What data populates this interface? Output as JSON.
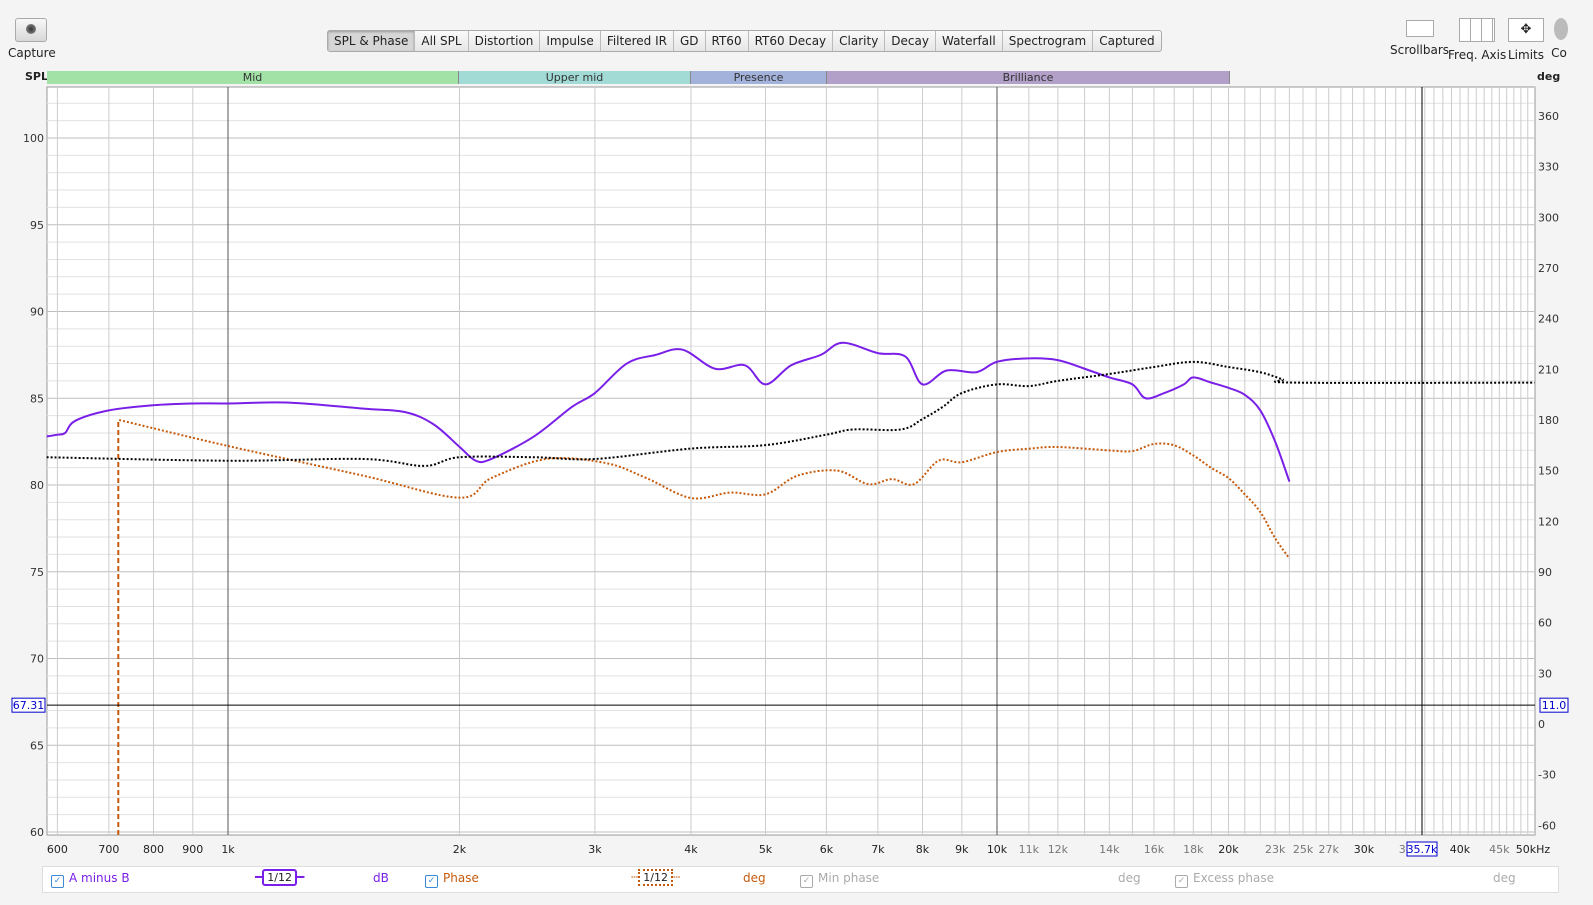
{
  "toolbar": {
    "capture": "Capture",
    "tabs": [
      "SPL & Phase",
      "All SPL",
      "Distortion",
      "Impulse",
      "Filtered IR",
      "GD",
      "RT60",
      "RT60 Decay",
      "Clarity",
      "Decay",
      "Waterfall",
      "Spectrogram",
      "Captured"
    ],
    "active_tab": "SPL & Phase",
    "tools": [
      "Scrollbars",
      "Freq. Axis",
      "Limits",
      "Co"
    ]
  },
  "axes": {
    "left_label": "SPL",
    "right_label": "deg",
    "x_unit_label": "50kHz"
  },
  "bands": [
    {
      "label": "Mid",
      "color": "#a2e2a6"
    },
    {
      "label": "Upper mid",
      "color": "#a2dad6"
    },
    {
      "label": "Presence",
      "color": "#a2b2da"
    },
    {
      "label": "Brilliance",
      "color": "#b2a0c8"
    }
  ],
  "cursor": {
    "spl": "67.31",
    "phase": "11.0",
    "freq": "35.7k"
  },
  "legend": {
    "items": [
      {
        "label": "A minus B",
        "smoothing": "1/12",
        "unit": "dB",
        "checked": true,
        "color": "#7a1fe8"
      },
      {
        "label": "Phase",
        "smoothing": "1/12",
        "unit": "deg",
        "checked": true,
        "color": "#c65a0c"
      },
      {
        "label": "Min phase",
        "unit": "deg",
        "checked": true,
        "disabled": true
      },
      {
        "label": "Excess phase",
        "unit": "deg",
        "checked": true,
        "disabled": true
      }
    ]
  },
  "chart_data": {
    "type": "line",
    "xscale": "log",
    "xlim": [
      581,
      50000
    ],
    "ylim": [
      59.83,
      102.94
    ],
    "y2lim": [
      -66,
      375
    ],
    "xticks": [
      [
        600,
        "600"
      ],
      [
        700,
        "700"
      ],
      [
        800,
        "800"
      ],
      [
        900,
        "900"
      ],
      [
        1000,
        "1k"
      ],
      [
        2000,
        "2k"
      ],
      [
        3000,
        "3k"
      ],
      [
        4000,
        "4k"
      ],
      [
        5000,
        "5k"
      ],
      [
        6000,
        "6k"
      ],
      [
        7000,
        "7k"
      ],
      [
        8000,
        "8k"
      ],
      [
        9000,
        "9k"
      ],
      [
        10000,
        "10k"
      ],
      [
        11000,
        "11k"
      ],
      [
        12000,
        "12k"
      ],
      [
        14000,
        "14k"
      ],
      [
        16000,
        "16k"
      ],
      [
        18000,
        "18k"
      ],
      [
        20000,
        "20k"
      ],
      [
        23000,
        "23k"
      ],
      [
        25000,
        "25k"
      ],
      [
        27000,
        "27k"
      ],
      [
        30000,
        "30k"
      ],
      [
        34000,
        "34"
      ],
      [
        40000,
        "40k"
      ],
      [
        45000,
        "45k"
      ]
    ],
    "yticks": [
      60,
      65,
      70,
      75,
      80,
      85,
      90,
      95,
      100
    ],
    "y2ticks": [
      -60,
      -30,
      0,
      30,
      60,
      90,
      120,
      150,
      180,
      210,
      240,
      270,
      300,
      330,
      360
    ],
    "series": [
      {
        "name": "A minus B",
        "axis": "left",
        "color": "#7a1fe8",
        "style": "solid",
        "points": [
          [
            581,
            82.8
          ],
          [
            600,
            82.9
          ],
          [
            614,
            83.0
          ],
          [
            633,
            83.7
          ],
          [
            700,
            84.3
          ],
          [
            800,
            84.6
          ],
          [
            900,
            84.7
          ],
          [
            1000,
            84.7
          ],
          [
            1200,
            84.75
          ],
          [
            1500,
            84.4
          ],
          [
            1700,
            84.2
          ],
          [
            1850,
            83.5
          ],
          [
            2000,
            82.2
          ],
          [
            2100,
            81.4
          ],
          [
            2200,
            81.5
          ],
          [
            2500,
            82.8
          ],
          [
            2800,
            84.5
          ],
          [
            3000,
            85.3
          ],
          [
            3300,
            87.0
          ],
          [
            3600,
            87.5
          ],
          [
            3900,
            87.8
          ],
          [
            4300,
            86.7
          ],
          [
            4700,
            86.9
          ],
          [
            5000,
            85.8
          ],
          [
            5400,
            86.9
          ],
          [
            5900,
            87.5
          ],
          [
            6300,
            88.2
          ],
          [
            7000,
            87.6
          ],
          [
            7600,
            87.4
          ],
          [
            8000,
            85.8
          ],
          [
            8600,
            86.6
          ],
          [
            9400,
            86.5
          ],
          [
            10000,
            87.1
          ],
          [
            11000,
            87.3
          ],
          [
            12000,
            87.2
          ],
          [
            13000,
            86.7
          ],
          [
            14000,
            86.2
          ],
          [
            15000,
            85.8
          ],
          [
            15600,
            85.0
          ],
          [
            16500,
            85.3
          ],
          [
            17500,
            85.8
          ],
          [
            18000,
            86.2
          ],
          [
            19000,
            85.9
          ],
          [
            20000,
            85.6
          ],
          [
            21000,
            85.2
          ],
          [
            22000,
            84.3
          ],
          [
            23000,
            82.5
          ],
          [
            24000,
            80.2
          ]
        ]
      },
      {
        "name": "Phase",
        "axis": "right",
        "color": "#c65a0c",
        "style": "dotted",
        "points": [
          [
            720,
            -66
          ],
          [
            722,
            180
          ],
          [
            1000,
            164.6
          ],
          [
            1500,
            147
          ],
          [
            2000,
            134
          ],
          [
            2200,
            145.6
          ],
          [
            2600,
            157
          ],
          [
            3100,
            154.5
          ],
          [
            3500,
            145.6
          ],
          [
            4000,
            133.8
          ],
          [
            4500,
            137
          ],
          [
            5000,
            136
          ],
          [
            5500,
            147
          ],
          [
            6200,
            150
          ],
          [
            6800,
            142
          ],
          [
            7300,
            145
          ],
          [
            7800,
            142
          ],
          [
            8400,
            156
          ],
          [
            9000,
            155
          ],
          [
            10000,
            161
          ],
          [
            11000,
            163
          ],
          [
            12000,
            164
          ],
          [
            14000,
            162
          ],
          [
            15000,
            161.6
          ],
          [
            16000,
            165.8
          ],
          [
            17000,
            165
          ],
          [
            18000,
            159
          ],
          [
            19000,
            151.6
          ],
          [
            20000,
            145.6
          ],
          [
            21000,
            136
          ],
          [
            22000,
            125.5
          ],
          [
            23000,
            110
          ],
          [
            24000,
            98
          ]
        ]
      },
      {
        "name": "",
        "axis": "left",
        "color": "#000000",
        "style": "dotted",
        "points": [
          [
            581,
            81.6
          ],
          [
            1000,
            81.4
          ],
          [
            1500,
            81.5
          ],
          [
            1800,
            81.1
          ],
          [
            2000,
            81.6
          ],
          [
            2500,
            81.6
          ],
          [
            3000,
            81.5
          ],
          [
            4000,
            82.1
          ],
          [
            5000,
            82.3
          ],
          [
            6000,
            82.9
          ],
          [
            6500,
            83.2
          ],
          [
            7500,
            83.2
          ],
          [
            8000,
            83.8
          ],
          [
            8500,
            84.5
          ],
          [
            9000,
            85.3
          ],
          [
            10000,
            85.8
          ],
          [
            11000,
            85.7
          ],
          [
            12000,
            86.0
          ],
          [
            14000,
            86.4
          ],
          [
            16000,
            86.8
          ],
          [
            18000,
            87.1
          ],
          [
            20000,
            86.8
          ],
          [
            22000,
            86.5
          ],
          [
            23500,
            86.1
          ],
          [
            24500,
            85.9
          ],
          [
            50000,
            85.9
          ]
        ]
      }
    ]
  }
}
